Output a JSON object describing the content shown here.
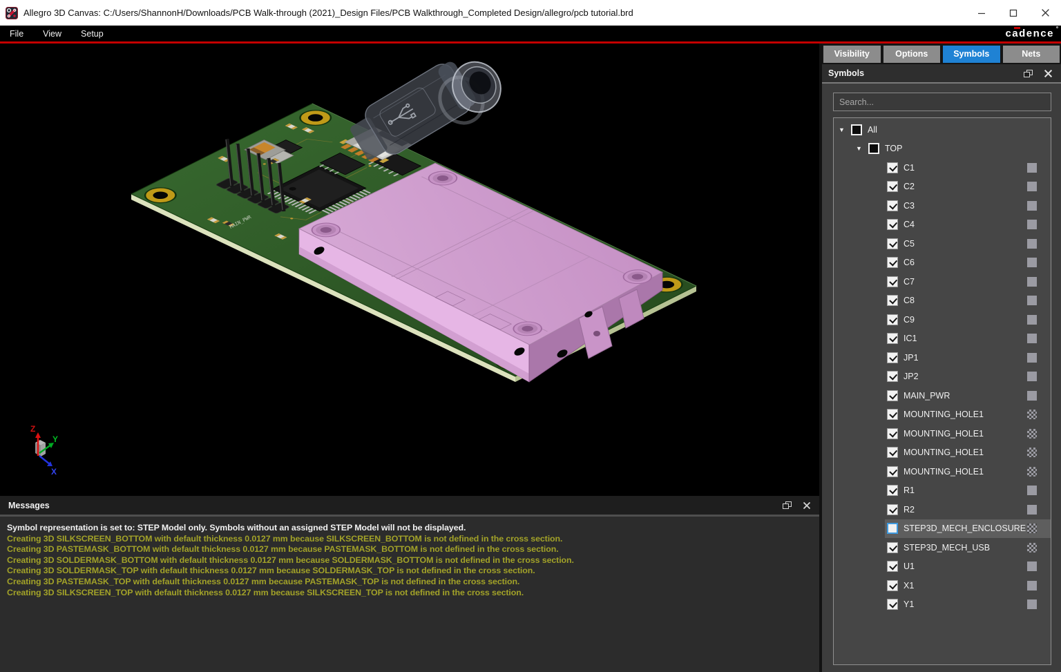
{
  "window": {
    "title": "Allegro 3D Canvas: C:/Users/ShannonH/Downloads/PCB Walk-through (2021)_Design Files/PCB Walkthrough_Completed Design/allegro/pcb tutorial.brd",
    "controls": [
      "minimize",
      "maximize",
      "close"
    ]
  },
  "menu": {
    "items": [
      "File",
      "View",
      "Setup"
    ],
    "brand": "cadence"
  },
  "colors": {
    "accent_blue": "#1f82d4",
    "tab_inactive": "#8c8c8c",
    "panel_bg": "#3d3d3d",
    "tree_bg": "#464646",
    "canvas_bg": "#000000",
    "message_bg": "#2c2c2c",
    "warning_text": "#a2a228",
    "info_text": "#f2f2f2",
    "red_line": "#c40000",
    "board_green": "#2f5c2a",
    "enclosure_pink": "#cf9ece",
    "swatch_gray": "#9b9ba3",
    "axis_x": "#3344ee",
    "axis_y": "#00bb22",
    "axis_z": "#dd2222"
  },
  "viewport": {
    "silkscreen": "MAIN_PWR",
    "axes": {
      "x": "X",
      "y": "Y",
      "z": "Z"
    }
  },
  "right_panel": {
    "tabs": [
      {
        "label": "Visibility",
        "active": false
      },
      {
        "label": "Options",
        "active": false
      },
      {
        "label": "Symbols",
        "active": true
      },
      {
        "label": "Nets",
        "active": false
      }
    ],
    "panel_title": "Symbols",
    "search_placeholder": "Search...",
    "tree": [
      {
        "label": "All",
        "level": 0,
        "state": "partial",
        "expander": true,
        "swatch": null,
        "selected": false
      },
      {
        "label": "TOP",
        "level": 1,
        "state": "partial",
        "expander": true,
        "swatch": null,
        "selected": false
      },
      {
        "label": "C1",
        "level": 2,
        "state": "checked",
        "expander": false,
        "swatch": "solid",
        "selected": false
      },
      {
        "label": "C2",
        "level": 2,
        "state": "checked",
        "expander": false,
        "swatch": "solid",
        "selected": false
      },
      {
        "label": "C3",
        "level": 2,
        "state": "checked",
        "expander": false,
        "swatch": "solid",
        "selected": false
      },
      {
        "label": "C4",
        "level": 2,
        "state": "checked",
        "expander": false,
        "swatch": "solid",
        "selected": false
      },
      {
        "label": "C5",
        "level": 2,
        "state": "checked",
        "expander": false,
        "swatch": "solid",
        "selected": false
      },
      {
        "label": "C6",
        "level": 2,
        "state": "checked",
        "expander": false,
        "swatch": "solid",
        "selected": false
      },
      {
        "label": "C7",
        "level": 2,
        "state": "checked",
        "expander": false,
        "swatch": "solid",
        "selected": false
      },
      {
        "label": "C8",
        "level": 2,
        "state": "checked",
        "expander": false,
        "swatch": "solid",
        "selected": false
      },
      {
        "label": "C9",
        "level": 2,
        "state": "checked",
        "expander": false,
        "swatch": "solid",
        "selected": false
      },
      {
        "label": "IC1",
        "level": 2,
        "state": "checked",
        "expander": false,
        "swatch": "solid",
        "selected": false
      },
      {
        "label": "JP1",
        "level": 2,
        "state": "checked",
        "expander": false,
        "swatch": "solid",
        "selected": false
      },
      {
        "label": "JP2",
        "level": 2,
        "state": "checked",
        "expander": false,
        "swatch": "solid",
        "selected": false
      },
      {
        "label": "MAIN_PWR",
        "level": 2,
        "state": "checked",
        "expander": false,
        "swatch": "solid",
        "selected": false
      },
      {
        "label": "MOUNTING_HOLE1",
        "level": 2,
        "state": "checked",
        "expander": false,
        "swatch": "hatch",
        "selected": false
      },
      {
        "label": "MOUNTING_HOLE1",
        "level": 2,
        "state": "checked",
        "expander": false,
        "swatch": "hatch",
        "selected": false
      },
      {
        "label": "MOUNTING_HOLE1",
        "level": 2,
        "state": "checked",
        "expander": false,
        "swatch": "hatch",
        "selected": false
      },
      {
        "label": "MOUNTING_HOLE1",
        "level": 2,
        "state": "checked",
        "expander": false,
        "swatch": "hatch",
        "selected": false
      },
      {
        "label": "R1",
        "level": 2,
        "state": "checked",
        "expander": false,
        "swatch": "solid",
        "selected": false
      },
      {
        "label": "R2",
        "level": 2,
        "state": "checked",
        "expander": false,
        "swatch": "solid",
        "selected": false
      },
      {
        "label": "STEP3D_MECH_ENCLOSURE",
        "level": 2,
        "state": "unchecked",
        "expander": false,
        "swatch": "hatch",
        "selected": true
      },
      {
        "label": "STEP3D_MECH_USB",
        "level": 2,
        "state": "checked",
        "expander": false,
        "swatch": "hatch",
        "selected": false
      },
      {
        "label": "U1",
        "level": 2,
        "state": "checked",
        "expander": false,
        "swatch": "solid",
        "selected": false
      },
      {
        "label": "X1",
        "level": 2,
        "state": "checked",
        "expander": false,
        "swatch": "solid",
        "selected": false
      },
      {
        "label": "Y1",
        "level": 2,
        "state": "checked",
        "expander": false,
        "swatch": "solid",
        "selected": false
      }
    ]
  },
  "messages": {
    "title": "Messages",
    "lines": [
      {
        "type": "info",
        "text": "Symbol representation is set to: STEP Model only.  Symbols without an assigned STEP Model will not be displayed."
      },
      {
        "type": "warning",
        "text": "Creating 3D SILKSCREEN_BOTTOM with default thickness 0.0127 mm because SILKSCREEN_BOTTOM is not defined in the cross section."
      },
      {
        "type": "warning",
        "text": "Creating 3D PASTEMASK_BOTTOM with default thickness 0.0127 mm because PASTEMASK_BOTTOM is not defined in the cross section."
      },
      {
        "type": "warning",
        "text": "Creating 3D SOLDERMASK_BOTTOM with default thickness 0.0127 mm because SOLDERMASK_BOTTOM is not defined in the cross section."
      },
      {
        "type": "warning",
        "text": "Creating 3D SOLDERMASK_TOP with default thickness 0.0127 mm because SOLDERMASK_TOP is not defined in the cross section."
      },
      {
        "type": "warning",
        "text": "Creating 3D PASTEMASK_TOP with default thickness 0.0127 mm because PASTEMASK_TOP is not defined in the cross section."
      },
      {
        "type": "warning",
        "text": "Creating 3D SILKSCREEN_TOP with default thickness 0.0127 mm because SILKSCREEN_TOP is not defined in the cross section."
      }
    ]
  }
}
